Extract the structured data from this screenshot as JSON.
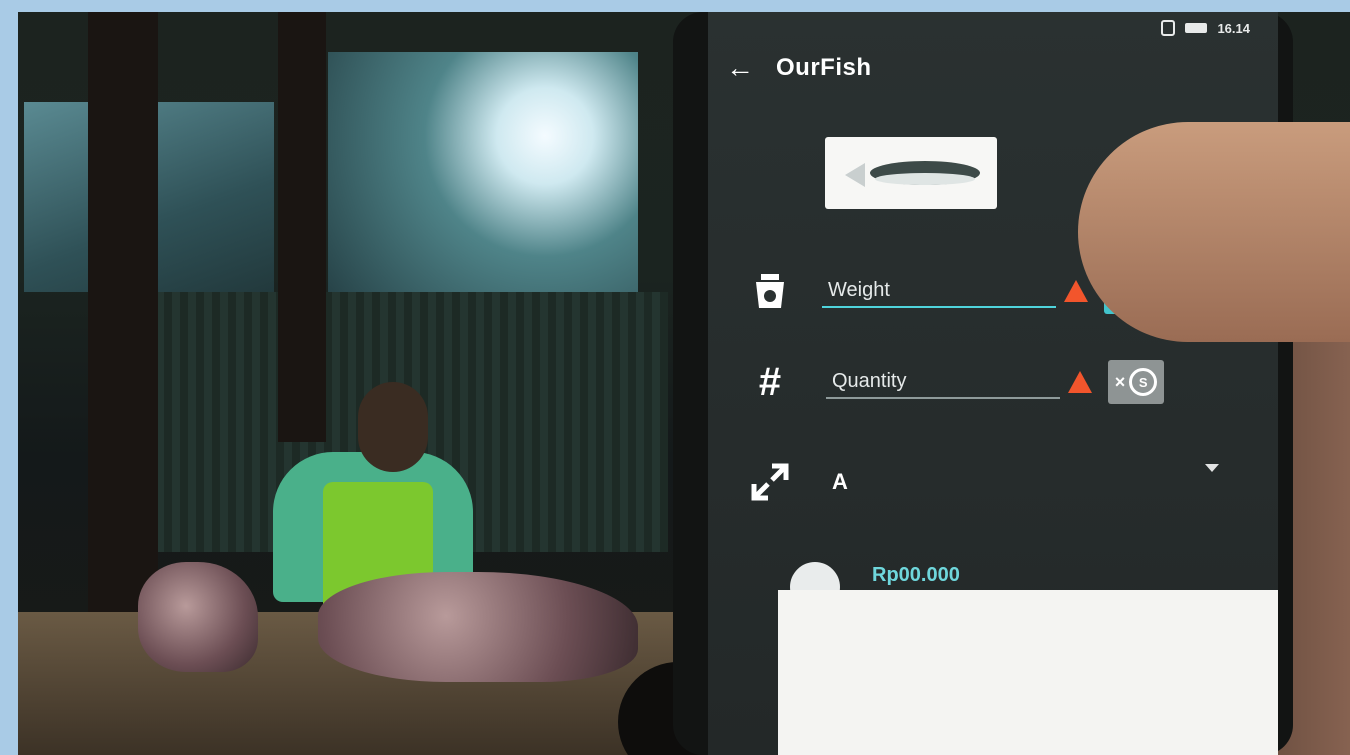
{
  "status_bar": {
    "time": "16.14"
  },
  "app_bar": {
    "title": "OurFish",
    "back_icon": "arrow-left-icon"
  },
  "form": {
    "weight": {
      "placeholder": "Weight",
      "icon": "scale-icon",
      "toggle_symbol": "×"
    },
    "quantity": {
      "placeholder": "Quantity",
      "icon": "hash-icon",
      "toggle_symbol": "×"
    },
    "size": {
      "value": "A",
      "icon": "expand-arrows-icon"
    },
    "price": {
      "value": "Rp00.000"
    }
  },
  "colors": {
    "accent": "#42c4cc",
    "warning": "#f2552c",
    "screen_bg": "#2a3131"
  }
}
